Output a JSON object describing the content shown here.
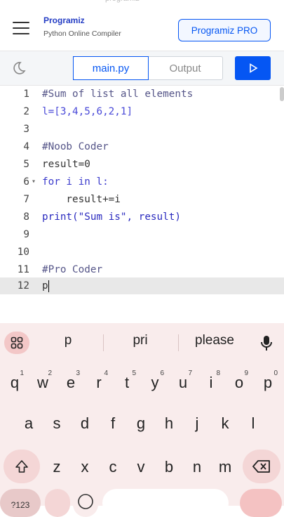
{
  "header": {
    "logo_name": "Programiz",
    "logo_subtitle": "Python Online Compiler",
    "pro_button": "Programiz PRO"
  },
  "toolbar": {
    "tab_file": "main.py",
    "tab_output": "Output"
  },
  "editor": {
    "lines": [
      {
        "n": "1",
        "text": "#Sum of list all elements"
      },
      {
        "n": "2",
        "text": "l=[3,4,5,6,2,1]"
      },
      {
        "n": "3",
        "text": ""
      },
      {
        "n": "4",
        "text": "#Noob Coder"
      },
      {
        "n": "5",
        "text": "result=0"
      },
      {
        "n": "6",
        "text": "for i in l:"
      },
      {
        "n": "7",
        "text": "    result+=i"
      },
      {
        "n": "8",
        "text": "print(\"Sum is\", result)"
      },
      {
        "n": "9",
        "text": ""
      },
      {
        "n": "10",
        "text": ""
      },
      {
        "n": "11",
        "text": "#Pro Coder"
      },
      {
        "n": "12",
        "text": "p"
      }
    ]
  },
  "keyboard": {
    "suggestions": [
      "p",
      "pri",
      "please"
    ],
    "row1": [
      "q",
      "w",
      "e",
      "r",
      "t",
      "y",
      "u",
      "i",
      "o",
      "p"
    ],
    "row1_hints": [
      "1",
      "2",
      "3",
      "4",
      "5",
      "6",
      "7",
      "8",
      "9",
      "0"
    ],
    "row2": [
      "a",
      "s",
      "d",
      "f",
      "g",
      "h",
      "j",
      "k",
      "l"
    ],
    "row3": [
      "z",
      "x",
      "c",
      "v",
      "b",
      "n",
      "m"
    ],
    "bottom_left": "?123"
  },
  "colors": {
    "accent": "#0556f3",
    "keyboard_bg": "#f9ecec"
  }
}
